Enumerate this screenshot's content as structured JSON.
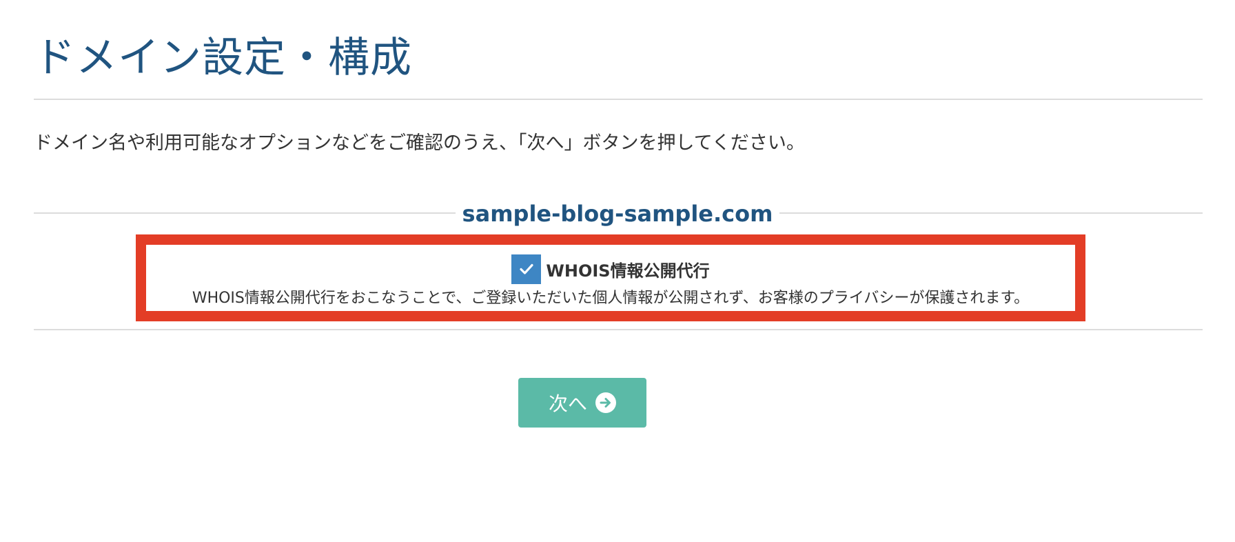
{
  "page": {
    "title": "ドメイン設定・構成",
    "intro": "ドメイン名や利用可能なオプションなどをご確認のうえ、「次へ」ボタンを押してください。"
  },
  "domain": {
    "name": "sample-blog-sample.com"
  },
  "option": {
    "label": "WHOIS情報公開代行",
    "checked": true,
    "description": "WHOIS情報公開代行をおこなうことで、ご登録いただいた個人情報が公開されず、お客様のプライバシーが保護されます。",
    "highlight_color": "#e33d26",
    "checkbox_color": "#3e86c4"
  },
  "actions": {
    "next_label": "次へ",
    "next_icon": "arrow-circle-right-icon",
    "button_color": "#5bbaa7"
  },
  "colors": {
    "title": "#205480",
    "domain": "#205480",
    "text": "#333333",
    "rule": "#dcdcdc"
  }
}
